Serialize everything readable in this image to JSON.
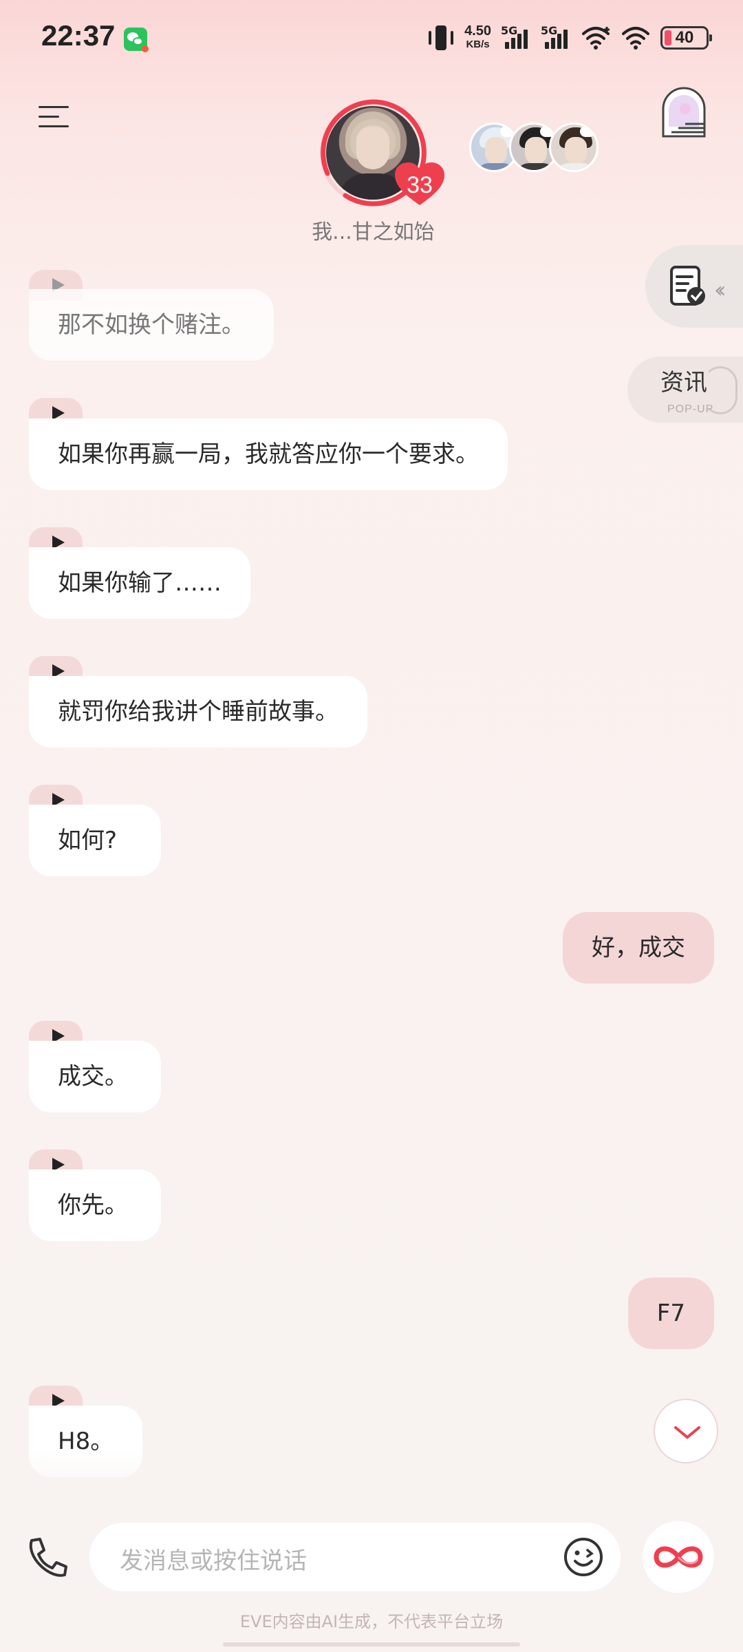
{
  "status_bar": {
    "time": "22:37",
    "net_speed_value": "4.50",
    "net_speed_unit": "KB/s",
    "sim1": "5G",
    "sim2": "5G",
    "battery": "40",
    "battery_level_percent": 40
  },
  "header": {
    "character_name": "我...甘之如饴",
    "affection_level": "33"
  },
  "side_widgets": {
    "news_label": "资讯",
    "news_sublabel": "POP-UP"
  },
  "messages": [
    {
      "from": "character",
      "text": "那不如换个赌注。"
    },
    {
      "from": "character",
      "text": "如果你再赢一局，我就答应你一个要求。"
    },
    {
      "from": "character",
      "text": "如果你输了……"
    },
    {
      "from": "character",
      "text": "就罚你给我讲个睡前故事。"
    },
    {
      "from": "character",
      "text": "如何?"
    },
    {
      "from": "user",
      "text": "好，成交"
    },
    {
      "from": "character",
      "text": "成交。"
    },
    {
      "from": "character",
      "text": "你先。"
    },
    {
      "from": "user",
      "text": "F7"
    },
    {
      "from": "character",
      "text": "H8。"
    }
  ],
  "input": {
    "placeholder": "发消息或按住说话"
  },
  "footer": {
    "disclaimer": "EVE内容由AI生成，不代表平台立场"
  },
  "colors": {
    "accent": "#ef3f4f",
    "user_bubble": "#f4d6d6",
    "play_tab": "#f4d9d9"
  }
}
